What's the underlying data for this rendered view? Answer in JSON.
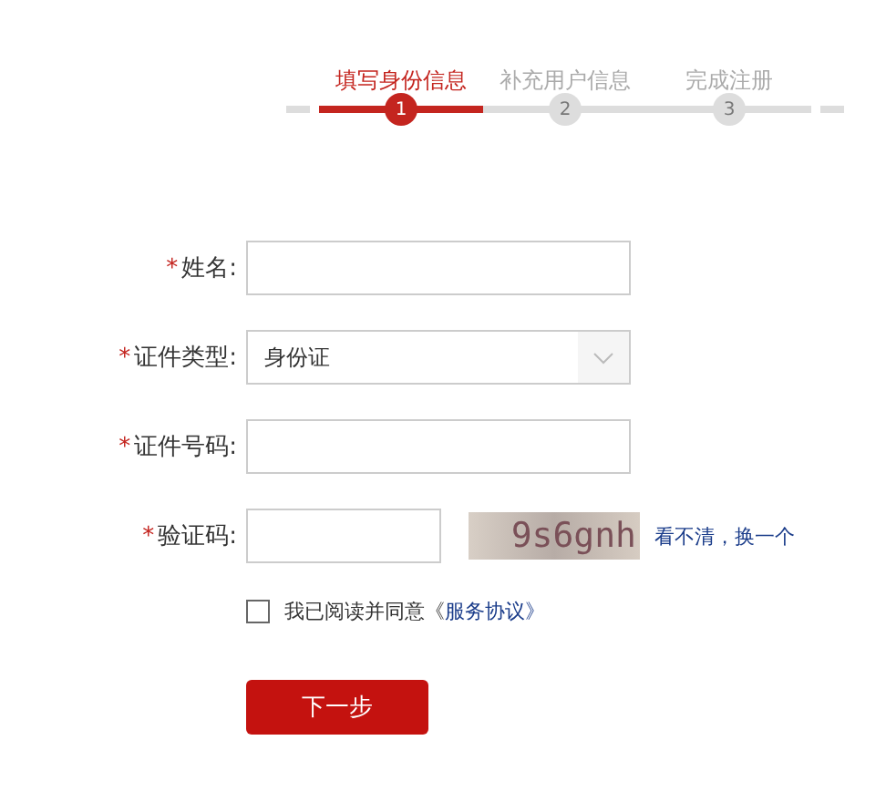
{
  "steps": [
    {
      "label": "填写身份信息",
      "number": "1",
      "selected": true
    },
    {
      "label": "补充用户信息",
      "number": "2",
      "selected": false
    },
    {
      "label": "完成注册",
      "number": "3",
      "selected": false
    }
  ],
  "fields": [
    {
      "kind": "text",
      "marker": "*",
      "label": "姓名:"
    },
    {
      "kind": "select",
      "marker": "*",
      "label": "证件类型:",
      "value": "身份证"
    },
    {
      "kind": "text",
      "marker": "*",
      "label": "证件号码:"
    },
    {
      "kind": "captcha",
      "marker": "*",
      "label": "验证码:",
      "captcha": "9s6gnh",
      "refresh": "看不清，换一个"
    }
  ],
  "agreement": {
    "checked": false,
    "text": "我已阅读并同意《",
    "link": "服务协议》"
  },
  "next_button": "下一步"
}
